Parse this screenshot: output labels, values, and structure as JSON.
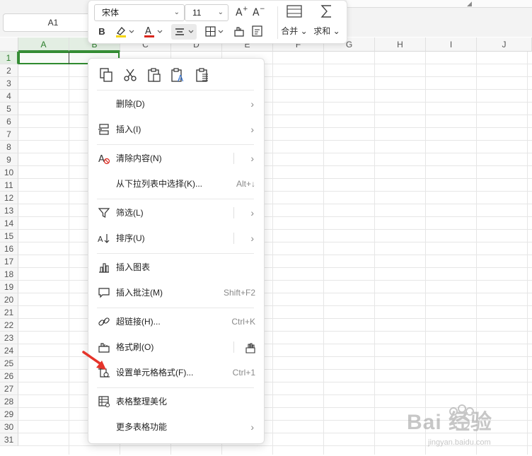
{
  "namebox": {
    "value": "A1"
  },
  "grid": {
    "columns": [
      "A",
      "B",
      "C",
      "D",
      "E",
      "F",
      "G",
      "H",
      "I",
      "J"
    ],
    "rows": [
      "1",
      "2",
      "3",
      "4",
      "5",
      "6",
      "7",
      "8",
      "9",
      "10",
      "11",
      "12",
      "13",
      "14",
      "15",
      "16",
      "17",
      "18",
      "19",
      "20",
      "21",
      "22",
      "23",
      "24",
      "25",
      "26",
      "27",
      "28",
      "29",
      "30",
      "31"
    ],
    "selected_columns": [
      "A",
      "B"
    ],
    "selected_row": "1",
    "accent": "#2f8a2f"
  },
  "mini_toolbar": {
    "font_name": "宋体",
    "font_size": "11",
    "bold_label": "B",
    "merge_label": "合并",
    "sum_label": "求和",
    "highlight_color": "#f5d50a",
    "font_color": "#d9261c"
  },
  "context_menu": {
    "clipboard_icons": [
      "copy-icon",
      "cut-icon",
      "paste-icon",
      "paste-text-icon",
      "paste-special-icon"
    ],
    "items": [
      {
        "id": "delete",
        "label": "删除(D)",
        "icon": "",
        "shortcut": "",
        "submenu": true
      },
      {
        "id": "insert",
        "label": "插入(I)",
        "icon": "insert-icon",
        "shortcut": "",
        "submenu": true
      },
      {
        "id": "clear",
        "label": "清除内容(N)",
        "icon": "clear-content-icon",
        "shortcut": "",
        "submenu": true
      },
      {
        "id": "pick",
        "label": "从下拉列表中选择(K)...",
        "icon": "",
        "shortcut": "Alt+↓",
        "submenu": false
      },
      {
        "id": "filter",
        "label": "筛选(L)",
        "icon": "filter-icon",
        "shortcut": "",
        "submenu": true
      },
      {
        "id": "sort",
        "label": "排序(U)",
        "icon": "sort-icon",
        "shortcut": "",
        "submenu": true
      },
      {
        "id": "chart",
        "label": "插入图表",
        "icon": "chart-icon",
        "shortcut": "",
        "submenu": false
      },
      {
        "id": "comment",
        "label": "插入批注(M)",
        "icon": "comment-icon",
        "shortcut": "Shift+F2",
        "submenu": false
      },
      {
        "id": "link",
        "label": "超链接(H)...",
        "icon": "link-icon",
        "shortcut": "Ctrl+K",
        "submenu": false
      },
      {
        "id": "painter",
        "label": "格式刷(O)",
        "icon": "format-painter-icon",
        "shortcut": "",
        "submenu": false
      },
      {
        "id": "format",
        "label": "设置单元格格式(F)...",
        "icon": "cell-format-icon",
        "shortcut": "Ctrl+1",
        "submenu": false
      },
      {
        "id": "beautify",
        "label": "表格整理美化",
        "icon": "table-beautify-icon",
        "shortcut": "",
        "submenu": false
      },
      {
        "id": "more",
        "label": "更多表格功能",
        "icon": "",
        "shortcut": "",
        "submenu": true
      }
    ]
  },
  "annotation": {
    "pointer_color": "#e5342a"
  },
  "watermark": {
    "text": "Bai 经验",
    "subtext": "jingyan.baidu.com"
  }
}
